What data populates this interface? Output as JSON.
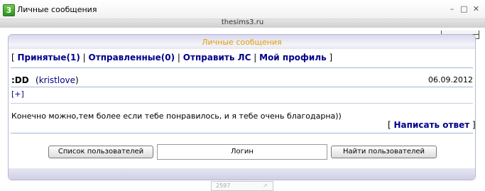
{
  "window": {
    "title": "Личные сообщения",
    "icon": "sims3-app-icon",
    "minimize": "–",
    "maximize": "□",
    "close": "✕"
  },
  "site": {
    "name": "thesims3.ru"
  },
  "panel": {
    "title": "Личные сообщения"
  },
  "nav": {
    "open_bracket": "[",
    "close_bracket": "]",
    "separator": "|",
    "items": [
      "Принятые(1)",
      "Отправленные(0)",
      "Отправить ЛС",
      "Мой профиль"
    ]
  },
  "message": {
    "subject": ":DD",
    "author_open": "(",
    "author": "kristlove",
    "author_close": ")",
    "date": "06.09.2012",
    "expand": "[+]",
    "body": "Конечно можно,тем более если тебе понравилось, и я тебе очень благодарна))"
  },
  "reply": {
    "open": "[",
    "label": "Написать ответ",
    "close": "]"
  },
  "search": {
    "users_button": "Список пользователей",
    "login_value": "Логин",
    "find_button": "Найти пользователей"
  },
  "counter": {
    "text": "2597"
  }
}
